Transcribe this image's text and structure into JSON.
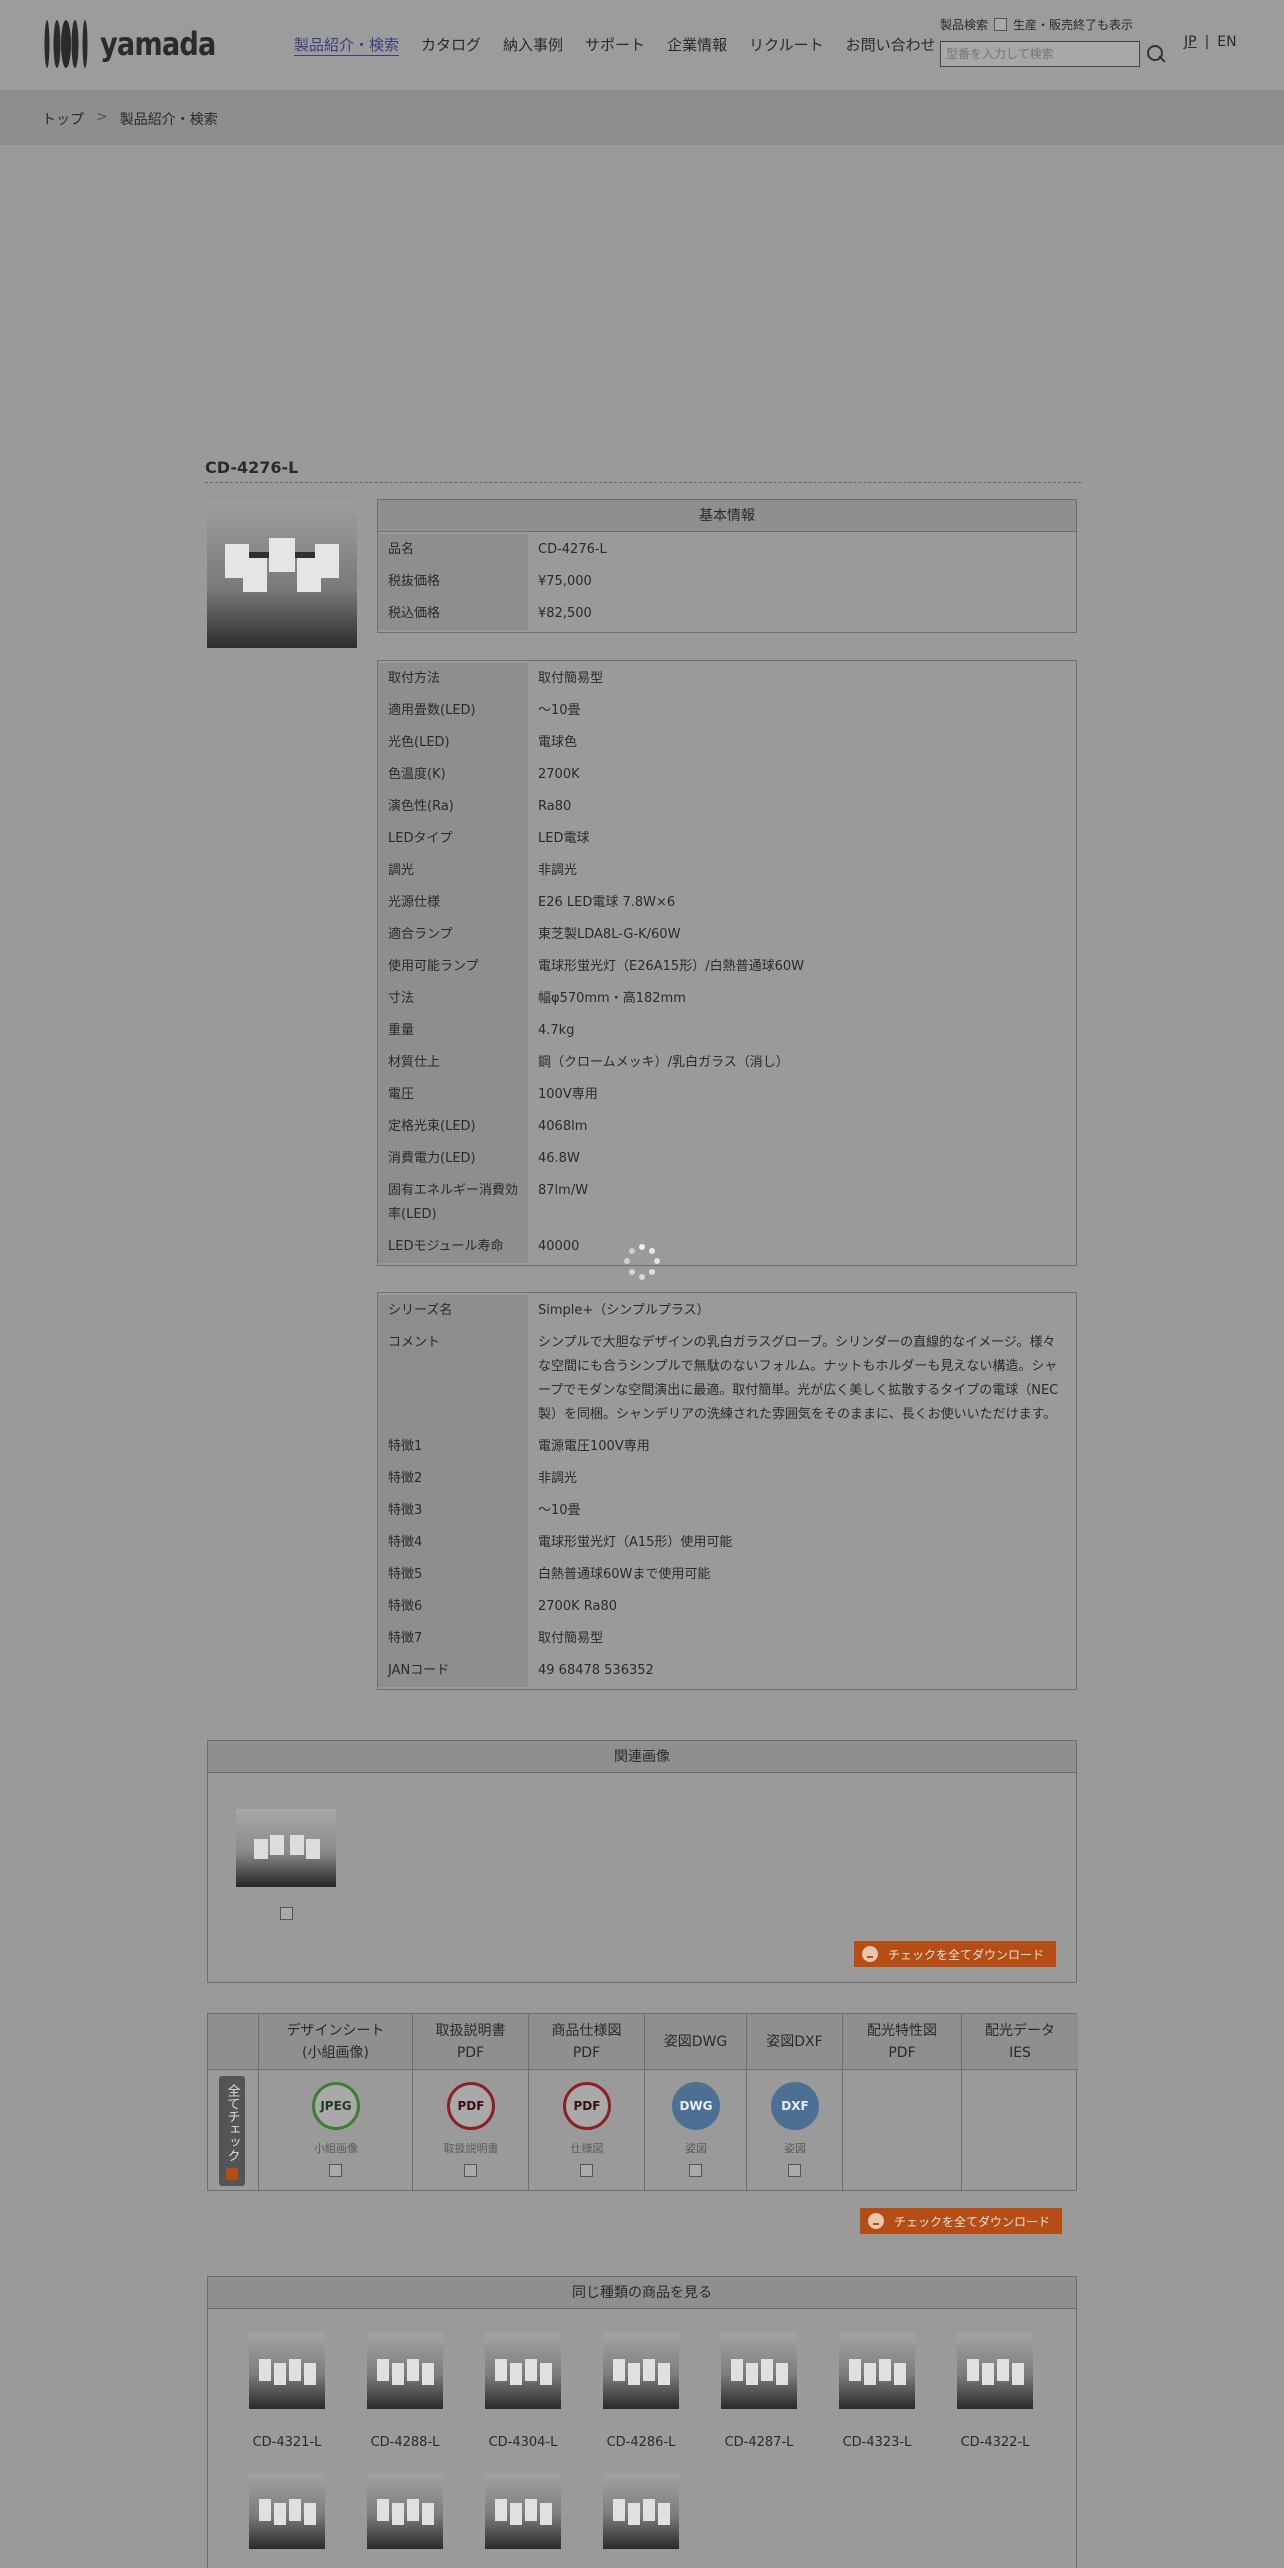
{
  "header": {
    "logo_text": "yamada",
    "nav": [
      "製品紹介・検索",
      "カタログ",
      "納入事例",
      "サポート",
      "企業情報",
      "リクルート",
      "お問い合わせ"
    ],
    "search_label": "製品検索",
    "discontinued_label": "生産・販売終了も表示",
    "search_placeholder": "型番を入力して検索",
    "lang_jp": "JP",
    "lang_sep": "|",
    "lang_en": "EN"
  },
  "breadcrumb": {
    "home": "トップ",
    "sep": ">",
    "current": "製品紹介・検索"
  },
  "product": {
    "title": "CD-4276-L",
    "basic_head": "基本情報",
    "basic": [
      {
        "k": "品名",
        "v": "CD-4276-L"
      },
      {
        "k": "税抜価格",
        "v": "¥75,000"
      },
      {
        "k": "税込価格",
        "v": "¥82,500"
      }
    ],
    "specs": [
      {
        "k": "取付方法",
        "v": "取付簡易型"
      },
      {
        "k": "適用畳数(LED)",
        "v": "〜10畳"
      },
      {
        "k": "光色(LED)",
        "v": "電球色"
      },
      {
        "k": "色温度(K)",
        "v": "2700K"
      },
      {
        "k": "演色性(Ra)",
        "v": "Ra80"
      },
      {
        "k": "LEDタイプ",
        "v": "LED電球"
      },
      {
        "k": "調光",
        "v": "非調光"
      },
      {
        "k": "光源仕様",
        "v": "E26 LED電球 7.8W×6"
      },
      {
        "k": "適合ランプ",
        "v": "東芝製LDA8L-G-K/60W"
      },
      {
        "k": "使用可能ランプ",
        "v": "電球形蛍光灯（E26A15形）/白熱普通球60W"
      },
      {
        "k": "寸法",
        "v": "幅φ570mm・高182mm"
      },
      {
        "k": "重量",
        "v": "4.7kg"
      },
      {
        "k": "材質仕上",
        "v": "鋼（クロームメッキ）/乳白ガラス（消し）"
      },
      {
        "k": "電圧",
        "v": "100V専用"
      },
      {
        "k": "定格光束(LED)",
        "v": "4068lm"
      },
      {
        "k": "消費電力(LED)",
        "v": "46.8W"
      },
      {
        "k": "固有エネルギー消費効率(LED)",
        "v": "87lm/W"
      },
      {
        "k": "LEDモジュール寿命",
        "v": "40000"
      }
    ],
    "details": [
      {
        "k": "シリーズ名",
        "v": "Simple+（シンプルプラス）"
      },
      {
        "k": "コメント",
        "v": "シンプルで大胆なデザインの乳白ガラスグローブ。シリンダーの直線的なイメージ。様々な空間にも合うシンプルで無駄のないフォルム。ナットもホルダーも見えない構造。シャープでモダンな空間演出に最適。取付簡単。光が広く美しく拡散するタイプの電球（NEC製）を同梱。シャンデリアの洗練された雰囲気をそのままに、長くお使いいただけます。"
      },
      {
        "k": "特徴1",
        "v": "電源電圧100V専用"
      },
      {
        "k": "特徴2",
        "v": "非調光"
      },
      {
        "k": "特徴3",
        "v": "〜10畳"
      },
      {
        "k": "特徴4",
        "v": "電球形蛍光灯（A15形）使用可能"
      },
      {
        "k": "特徴5",
        "v": "白熱普通球60Wまで使用可能"
      },
      {
        "k": "特徴6",
        "v": "2700K Ra80"
      },
      {
        "k": "特徴7",
        "v": "取付簡易型"
      },
      {
        "k": "JANコード",
        "v": "49 68478 536352"
      }
    ]
  },
  "related": {
    "head": "関連画像",
    "download_all": "チェックを全てダウンロード"
  },
  "downloads": {
    "all_check": "全てチェック",
    "columns": [
      {
        "h1": "デザインシート",
        "h2": "(小組画像)",
        "badge": "JPEG",
        "label": "小組画像"
      },
      {
        "h1": "取扱説明書",
        "h2": "PDF",
        "badge": "PDF",
        "label": "取扱説明書"
      },
      {
        "h1": "商品仕様図",
        "h2": "PDF",
        "badge": "PDF",
        "label": "仕様図"
      },
      {
        "h1": "姿図DWG",
        "h2": "",
        "badge": "DWG",
        "label": "姿図"
      },
      {
        "h1": "姿図DXF",
        "h2": "",
        "badge": "DXF",
        "label": "姿図"
      },
      {
        "h1": "配光特性図",
        "h2": "PDF",
        "badge": "",
        "label": ""
      },
      {
        "h1": "配光データ",
        "h2": "IES",
        "badge": "",
        "label": ""
      }
    ],
    "download_all": "チェックを全てダウンロード",
    "colors": {
      "jpeg": "#3f7d34",
      "pdf": "#8b1f24",
      "dwg": "#4e6f94",
      "dxf": "#4e6f94"
    }
  },
  "same_kind": {
    "head": "同じ種類の商品を見る",
    "items": [
      "CD-4321-L",
      "CD-4288-L",
      "CD-4304-L",
      "CD-4286-L",
      "CD-4287-L",
      "CD-4323-L",
      "CD-4322-L",
      "",
      "",
      "",
      ""
    ]
  }
}
